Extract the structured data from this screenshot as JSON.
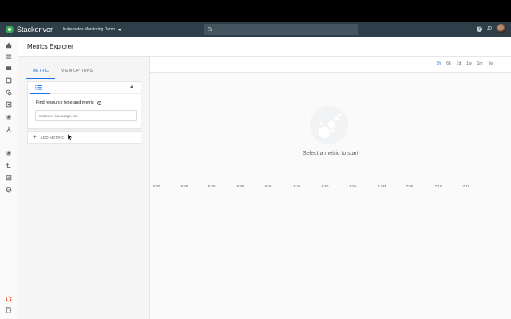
{
  "app": {
    "logo_text": "Stackdriver",
    "project": "Kubernetes Monitoring Demo",
    "search_placeholder": "",
    "user_initials": "JD"
  },
  "page": {
    "title": "Metrics Explorer"
  },
  "tabs": [
    {
      "label": "METRIC",
      "active": true
    },
    {
      "label": "VIEW OPTIONS",
      "active": false
    }
  ],
  "metric_card": {
    "find_label": "Find resource type and metric",
    "find_placeholder": "instance, cpu usage, etc.",
    "add_metric_label": "ADD METRIC"
  },
  "time_ranges": [
    {
      "label": "1h",
      "active": true
    },
    {
      "label": "6h",
      "active": false
    },
    {
      "label": "1d",
      "active": false
    },
    {
      "label": "1w",
      "active": false
    },
    {
      "label": "1m",
      "active": false
    },
    {
      "label": "6w",
      "active": false
    }
  ],
  "empty_state": {
    "message": "Select a metric to start"
  },
  "x_axis_ticks": [
    "6:20",
    "6:25",
    "6:30",
    "6:35",
    "6:40",
    "6:45",
    "6:50",
    "6:55",
    "7 AM",
    "7:05",
    "7:10",
    "7:15"
  ],
  "sidebar_icons": [
    "home-icon",
    "dashboard-icon",
    "chat-icon",
    "shield-icon",
    "uptime-icon",
    "resources-icon",
    "alerting-icon",
    "groups-icon",
    "debug-icon",
    "trace-icon",
    "logging-icon",
    "profiler-icon",
    "settings-icon",
    "docs-icon"
  ],
  "colors": {
    "accent": "#1a73e8",
    "appbar": "#2f3f4a",
    "logo": "#34a853"
  }
}
